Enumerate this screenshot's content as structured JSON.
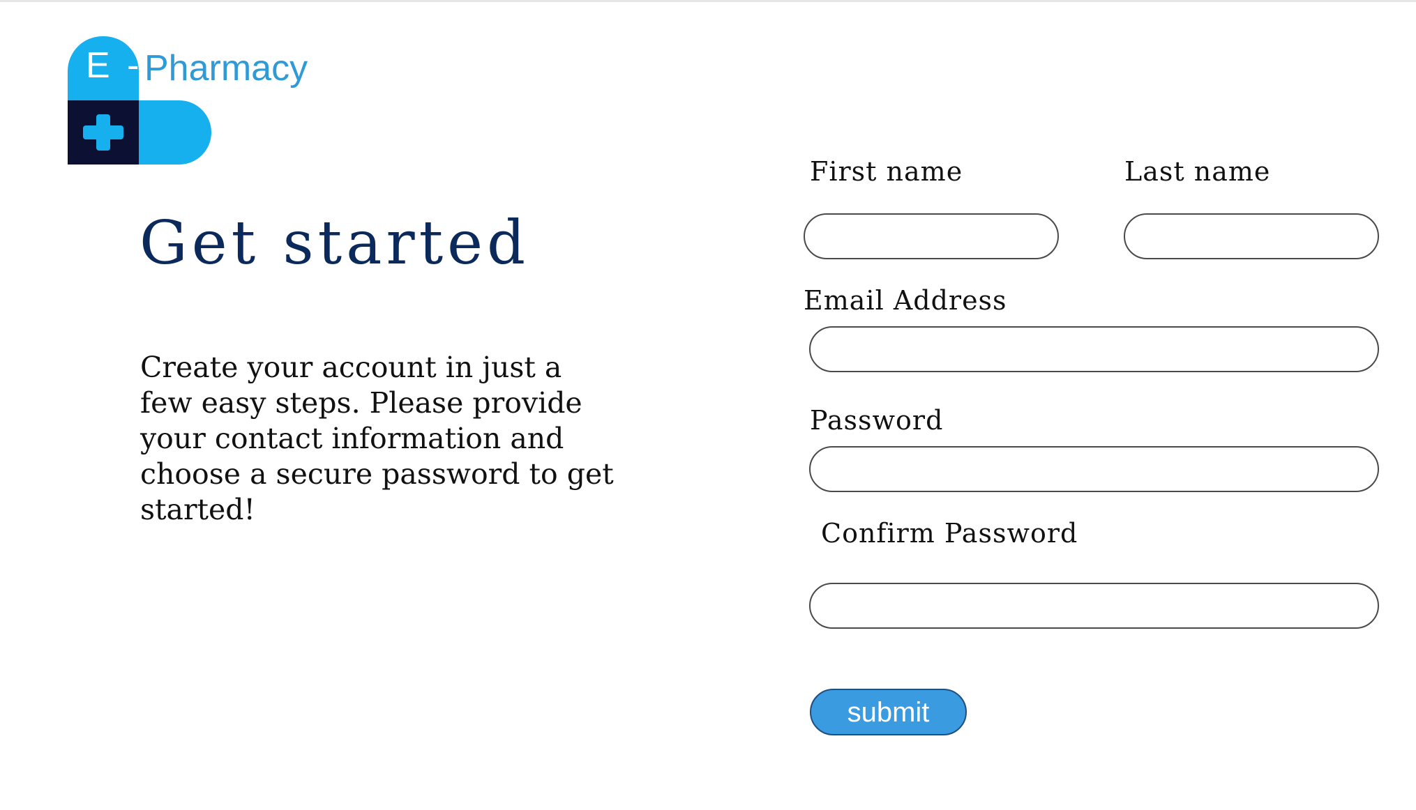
{
  "brand": {
    "logo_prefix": "E -",
    "logo_name": "Pharmacy"
  },
  "colors": {
    "brand_blue": "#17b0ef",
    "brand_dark": "#0c1033",
    "title_navy": "#0b2a5b",
    "button_blue": "#3a9be0"
  },
  "icons": {
    "logo_cross": "plus-cross-icon"
  },
  "hero": {
    "title": "Get started",
    "body": "Create your account in just a few easy steps. Please provide your contact information and choose a secure password to get started!"
  },
  "form": {
    "first_name": {
      "label": "First name",
      "value": ""
    },
    "last_name": {
      "label": "Last name",
      "value": ""
    },
    "email": {
      "label": "Email Address",
      "value": ""
    },
    "password": {
      "label": "Password",
      "value": ""
    },
    "confirm_password": {
      "label": "Confirm Password",
      "value": ""
    },
    "submit_label": "submit"
  }
}
